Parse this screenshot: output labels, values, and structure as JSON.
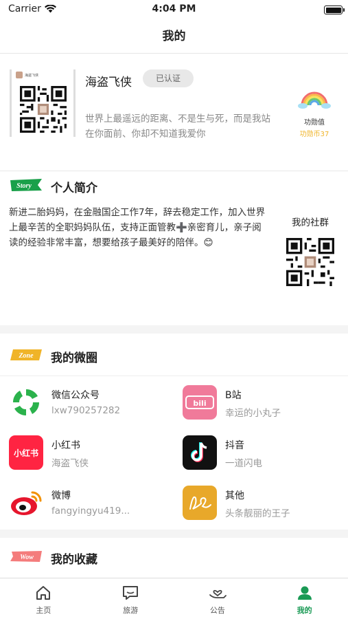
{
  "status_bar": {
    "carrier": "Carrier",
    "time": "4:04 PM"
  },
  "nav": {
    "title": "我的"
  },
  "profile": {
    "qr_mini_name": "海盗飞侠",
    "nickname": "海盗飞侠",
    "verified_label": "已认证",
    "signature": "世界上最遥远的距离、不是生与死，而是我站在你面前、你却不知道我爱你",
    "merit_label": "功勋值",
    "merit_coins": "功勋币37"
  },
  "intro": {
    "tag": "Story",
    "title": "个人简介",
    "text": "新进二胎妈妈，在金融国企工作7年，辞去稳定工作，加入世界上最辛苦的全职妈妈队伍，支持正面管教➕亲密育儿，亲子阅读的经验非常丰富，想要给孩子最美好的陪伴。😊",
    "community_label": "我的社群"
  },
  "micro_circle": {
    "tag": "Zone",
    "title": "我的微圈",
    "items": [
      {
        "name": "微信公众号",
        "handle": "lxw790257282",
        "icon": "wechat-official-icon"
      },
      {
        "name": "B站",
        "handle": "幸运的小丸子",
        "icon": "bilibili-icon"
      },
      {
        "name": "小红书",
        "handle": "海盗飞侠",
        "icon": "xiaohongshu-icon",
        "icon_text": "小红书"
      },
      {
        "name": "抖音",
        "handle": "一道闪电",
        "icon": "douyin-icon"
      },
      {
        "name": "微博",
        "handle": "fangyingyu419...",
        "icon": "weibo-icon"
      },
      {
        "name": "其他",
        "handle": "头条靓丽的王子",
        "icon": "other-icon"
      }
    ]
  },
  "favorites": {
    "tag": "Wow",
    "title": "我的收藏"
  },
  "tabbar": {
    "items": [
      {
        "label": "主页",
        "icon": "home-icon"
      },
      {
        "label": "旅游",
        "icon": "chat-icon"
      },
      {
        "label": "公告",
        "icon": "heart-hand-icon"
      },
      {
        "label": "我的",
        "icon": "person-icon"
      }
    ],
    "active_index": 3,
    "active_color": "#1a9a55"
  }
}
